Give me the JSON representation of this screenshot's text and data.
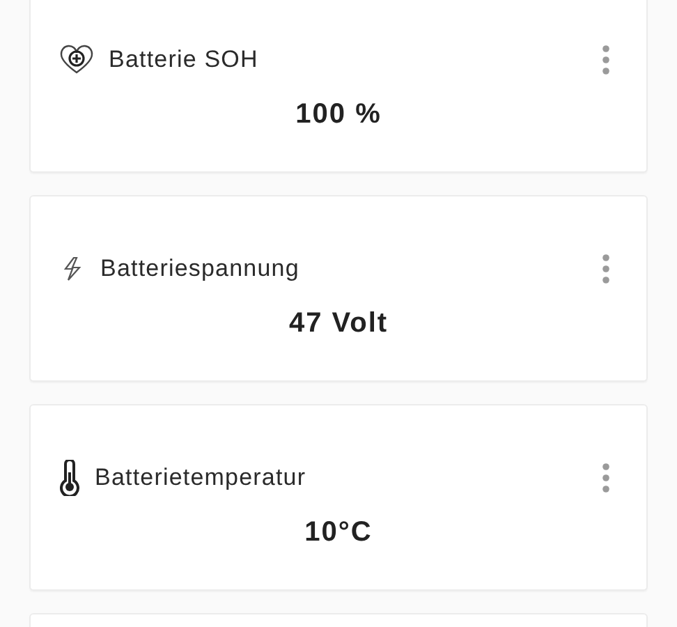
{
  "tiles": [
    {
      "kind": "health",
      "title": "Batterie SOH",
      "value": "100 %"
    },
    {
      "kind": "voltage",
      "title": "Batteriespannung",
      "value": "47 Volt"
    },
    {
      "kind": "temperature",
      "title": "Batterietemperatur",
      "value": "10°C"
    }
  ]
}
